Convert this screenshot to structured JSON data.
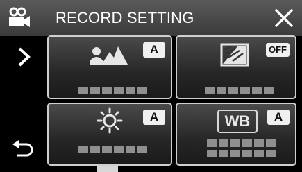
{
  "header": {
    "title": "RECORD SETTING",
    "mode_icon": "video-camera-icon",
    "close_icon": "close-icon"
  },
  "navigation": {
    "next_icon": "chevron-right-icon",
    "back_icon": "return-arrow-icon"
  },
  "tiles": [
    {
      "icon": "scene-select-icon",
      "badge": "A"
    },
    {
      "icon": "backlight-compensation-icon",
      "badge": "OFF"
    },
    {
      "icon": "brightness-icon",
      "badge": "A"
    },
    {
      "icon": "white-balance-icon",
      "icon_text": "WB",
      "badge": "A"
    }
  ],
  "colors": {
    "tile_border": "#cfcfcf",
    "badge_bg": "#f0f0f0",
    "placeholder_block": "#8f8f8f"
  }
}
